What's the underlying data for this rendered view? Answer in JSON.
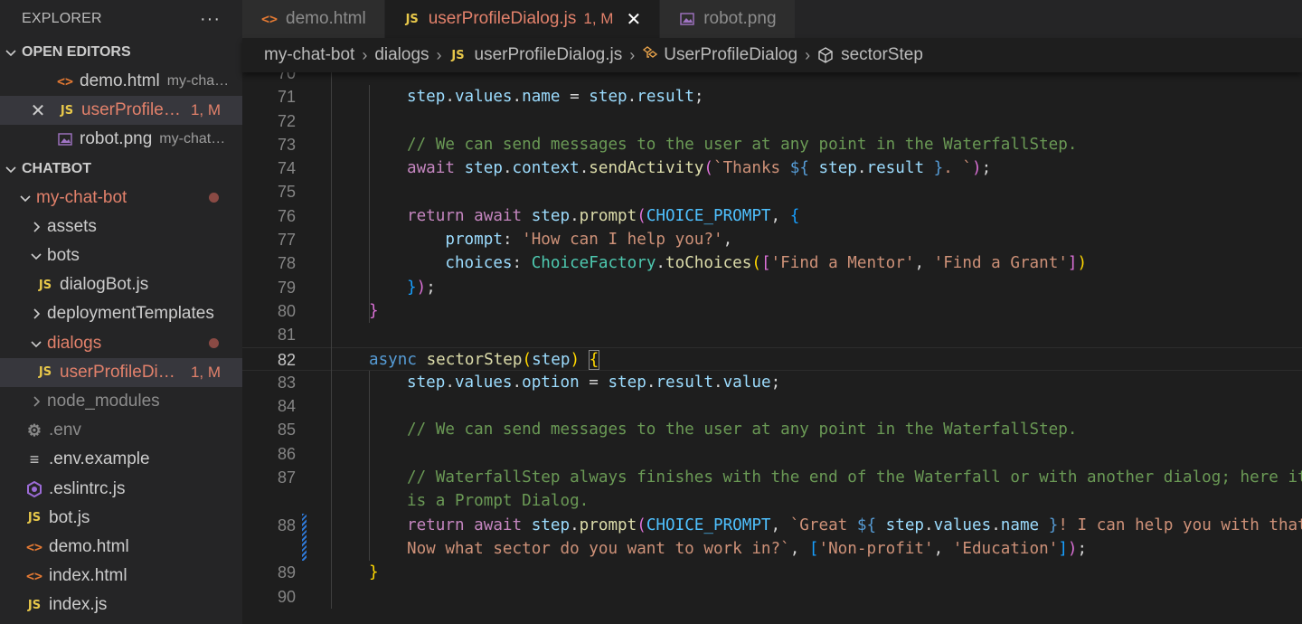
{
  "sidebar": {
    "title": "EXPLORER",
    "more_label": "···",
    "open_editors": {
      "title": "OPEN EDITORS",
      "items": [
        {
          "name": "demo.html",
          "desc": "my-cha…",
          "icon": "html-file-icon"
        },
        {
          "name": "userProfile…",
          "badge": "1, M",
          "icon": "js-file-icon"
        },
        {
          "name": "robot.png",
          "desc": "my-chat…",
          "icon": "image-file-icon"
        }
      ]
    },
    "workspace": {
      "title": "CHATBOT",
      "items": [
        {
          "label": "my-chat-bot"
        },
        {
          "label": "assets"
        },
        {
          "label": "bots"
        },
        {
          "label": "dialogBot.js"
        },
        {
          "label": "deploymentTemplates"
        },
        {
          "label": "dialogs"
        },
        {
          "label": "userProfileDi…",
          "badge": "1, M"
        },
        {
          "label": "node_modules"
        },
        {
          "label": ".env"
        },
        {
          "label": ".env.example"
        },
        {
          "label": ".eslintrc.js"
        },
        {
          "label": "bot.js"
        },
        {
          "label": "demo.html"
        },
        {
          "label": "index.html"
        },
        {
          "label": "index.js"
        }
      ]
    }
  },
  "tabs": [
    {
      "label": "demo.html",
      "icon": "html-file-icon"
    },
    {
      "label": "userProfileDialog.js",
      "badge": "1, M",
      "icon": "js-file-icon"
    },
    {
      "label": "robot.png",
      "icon": "image-file-icon"
    }
  ],
  "icon_glyphs": {
    "js": "JS",
    "html": "<>",
    "close": "✕"
  },
  "breadcrumb": {
    "items": [
      "my-chat-bot",
      "dialogs",
      "userProfileDialog.js",
      "UserProfileDialog",
      "sectorStep"
    ]
  },
  "editor": {
    "current_line": 82,
    "lines": [
      {
        "n": "70",
        "tokens": []
      },
      {
        "n": "71",
        "tokens": [
          [
            "v",
            "step"
          ],
          [
            "p",
            "."
          ],
          [
            "v",
            "values"
          ],
          [
            "p",
            "."
          ],
          [
            "v",
            "name"
          ],
          [
            "p",
            " = "
          ],
          [
            "v",
            "step"
          ],
          [
            "p",
            "."
          ],
          [
            "v",
            "result"
          ],
          [
            "p",
            ";"
          ]
        ]
      },
      {
        "n": "72",
        "tokens": []
      },
      {
        "n": "73",
        "tokens": [
          [
            "cm",
            "// We can send messages to the user at any point in the WaterfallStep."
          ]
        ]
      },
      {
        "n": "74",
        "tokens": [
          [
            "c",
            "await "
          ],
          [
            "v",
            "step"
          ],
          [
            "p",
            "."
          ],
          [
            "v",
            "context"
          ],
          [
            "p",
            "."
          ],
          [
            "f",
            "sendActivity"
          ],
          [
            "b2",
            "("
          ],
          [
            "s",
            "`Thanks "
          ],
          [
            "k",
            "${"
          ],
          [
            "p",
            " "
          ],
          [
            "v",
            "step"
          ],
          [
            "p",
            "."
          ],
          [
            "v",
            "result"
          ],
          [
            "p",
            " "
          ],
          [
            "k",
            "}"
          ],
          [
            "s",
            ". `"
          ],
          [
            "b2",
            ")"
          ],
          [
            "p",
            ";"
          ]
        ]
      },
      {
        "n": "75",
        "tokens": []
      },
      {
        "n": "76",
        "tokens": [
          [
            "c",
            "return await "
          ],
          [
            "v",
            "step"
          ],
          [
            "p",
            "."
          ],
          [
            "f",
            "prompt"
          ],
          [
            "b2",
            "("
          ],
          [
            "cn",
            "CHOICE_PROMPT"
          ],
          [
            "p",
            ", "
          ],
          [
            "b3",
            "{"
          ]
        ]
      },
      {
        "n": "77",
        "tokens": [
          [
            "p",
            "    "
          ],
          [
            "v",
            "prompt"
          ],
          [
            "p",
            ": "
          ],
          [
            "s",
            "'How can I help you?'"
          ],
          [
            "p",
            ","
          ]
        ]
      },
      {
        "n": "78",
        "tokens": [
          [
            "p",
            "    "
          ],
          [
            "v",
            "choices"
          ],
          [
            "p",
            ": "
          ],
          [
            "ty",
            "ChoiceFactory"
          ],
          [
            "p",
            "."
          ],
          [
            "f",
            "toChoices"
          ],
          [
            "b1",
            "("
          ],
          [
            "b2",
            "["
          ],
          [
            "s",
            "'Find a Mentor'"
          ],
          [
            "p",
            ", "
          ],
          [
            "s",
            "'Find a Grant'"
          ],
          [
            "b2",
            "]"
          ],
          [
            "b1",
            ")"
          ]
        ]
      },
      {
        "n": "79",
        "tokens": [
          [
            "b3",
            "}"
          ],
          [
            "b2",
            ")"
          ],
          [
            "p",
            ";"
          ]
        ]
      },
      {
        "n": "80",
        "tokens": [
          [
            "b2",
            "}"
          ]
        ]
      },
      {
        "n": "81",
        "tokens": []
      },
      {
        "n": "82",
        "tokens": [
          [
            "k",
            "async "
          ],
          [
            "f",
            "sectorStep"
          ],
          [
            "b1",
            "("
          ],
          [
            "v",
            "step"
          ],
          [
            "b1",
            ")"
          ],
          [
            "p",
            " "
          ],
          [
            "b1",
            "{"
          ]
        ]
      },
      {
        "n": "83",
        "tokens": [
          [
            "v",
            "step"
          ],
          [
            "p",
            "."
          ],
          [
            "v",
            "values"
          ],
          [
            "p",
            "."
          ],
          [
            "v",
            "option"
          ],
          [
            "p",
            " = "
          ],
          [
            "v",
            "step"
          ],
          [
            "p",
            "."
          ],
          [
            "v",
            "result"
          ],
          [
            "p",
            "."
          ],
          [
            "v",
            "value"
          ],
          [
            "p",
            ";"
          ]
        ]
      },
      {
        "n": "84",
        "tokens": []
      },
      {
        "n": "85",
        "tokens": [
          [
            "cm",
            "// We can send messages to the user at any point in the WaterfallStep."
          ]
        ]
      },
      {
        "n": "86",
        "tokens": []
      },
      {
        "n": "87",
        "tokens": [
          [
            "cm",
            "// WaterfallStep always finishes with the end of the Waterfall or with another dialog; here it"
          ]
        ]
      },
      {
        "n": "",
        "tokens": [
          [
            "cm",
            "is a Prompt Dialog."
          ]
        ]
      },
      {
        "n": "88",
        "tokens": [
          [
            "c",
            "return await "
          ],
          [
            "v",
            "step"
          ],
          [
            "p",
            "."
          ],
          [
            "f",
            "prompt"
          ],
          [
            "b2",
            "("
          ],
          [
            "cn",
            "CHOICE_PROMPT"
          ],
          [
            "p",
            ", "
          ],
          [
            "s",
            "`Great "
          ],
          [
            "k",
            "${"
          ],
          [
            "p",
            " "
          ],
          [
            "v",
            "step"
          ],
          [
            "p",
            "."
          ],
          [
            "v",
            "values"
          ],
          [
            "p",
            "."
          ],
          [
            "v",
            "name"
          ],
          [
            "p",
            " "
          ],
          [
            "k",
            "}"
          ],
          [
            "s",
            "! I can help you with that"
          ]
        ]
      },
      {
        "n": "",
        "tokens": [
          [
            "s",
            "Now what sector do you want to work in?`"
          ],
          [
            "p",
            ", "
          ],
          [
            "b3",
            "["
          ],
          [
            "s",
            "'Non-profit'"
          ],
          [
            "p",
            ", "
          ],
          [
            "s",
            "'Education'"
          ],
          [
            "b3",
            "]"
          ],
          [
            "b2",
            ")"
          ],
          [
            "p",
            ";"
          ]
        ]
      },
      {
        "n": "89",
        "tokens": [
          [
            "b1",
            "}"
          ]
        ]
      },
      {
        "n": "90",
        "tokens": []
      }
    ]
  }
}
